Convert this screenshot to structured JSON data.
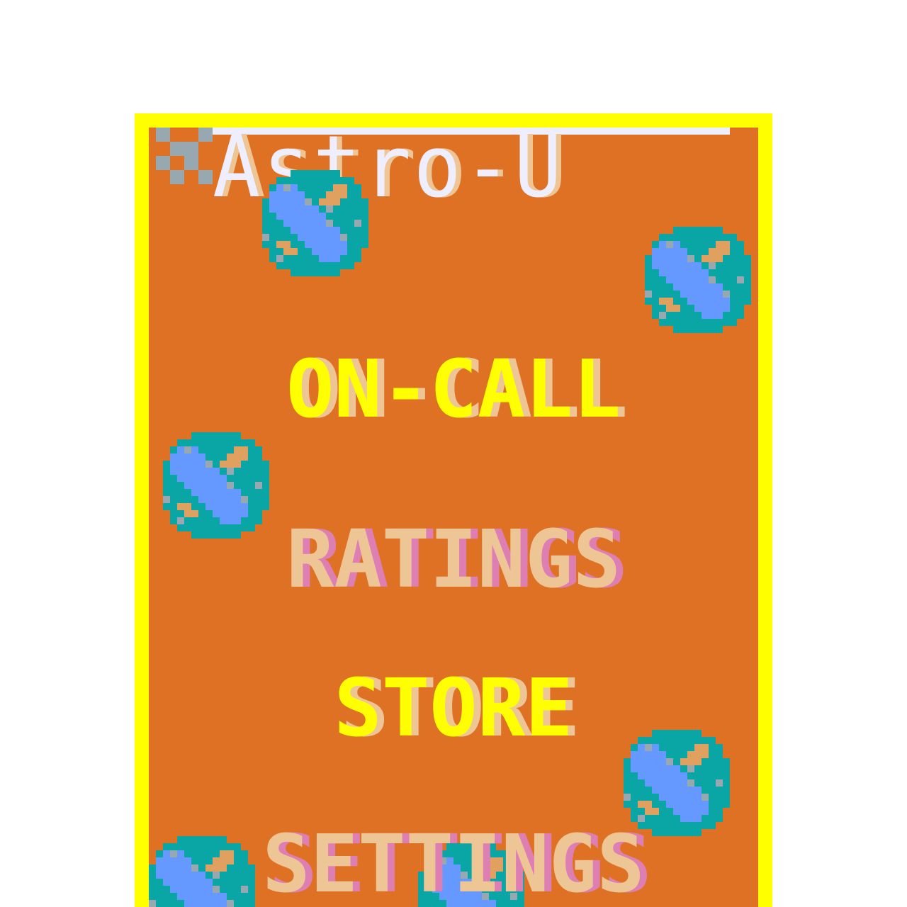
{
  "game": {
    "title": "Astro-U"
  },
  "menu": {
    "items": [
      {
        "label": "ON-CALL"
      },
      {
        "label": "RATINGS"
      },
      {
        "label": "STORE"
      },
      {
        "label": "SETTINGS"
      }
    ]
  },
  "colors": {
    "frame": "#ffff00",
    "background": "#df7125",
    "title_light": "#eeeeff",
    "title_shadow": "#eec595",
    "menu_yellow": "#ffff00",
    "menu_peach": "#eec595",
    "menu_pink": "#de7fb4",
    "ball_blue": "#6699ff",
    "ball_teal": "#0aa5a5",
    "ball_grey": "#98a8b0"
  },
  "icons": {
    "logo": "checker-star-icon",
    "decoration": "beach-ball-icon"
  }
}
